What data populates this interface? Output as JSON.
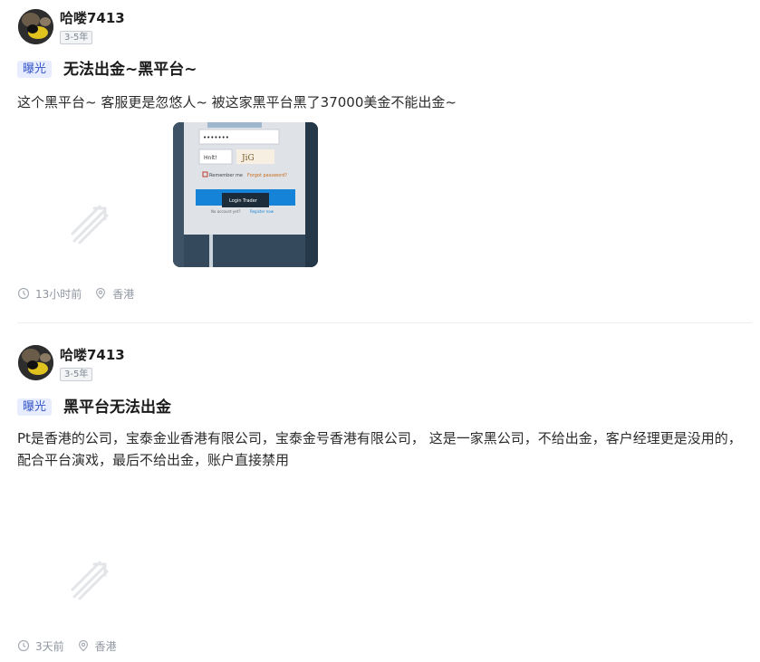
{
  "posts": [
    {
      "author": {
        "name": "哈喽7413",
        "badge": "3-5年"
      },
      "tag": "曝光",
      "title": "无法出金~黑平台~",
      "content": "这个黑平台~ 客服更是忽悠人~ 被这家黑平台黑了37000美金不能出金~",
      "image": {
        "password_dots": "•••••••",
        "captcha_field": "Hnlt!",
        "captcha_text": "JiG",
        "remember_label": "Remember me",
        "forgot_label": "Forgot password?",
        "login_button": "Login Trader",
        "register_prompt": "No account yet?",
        "register_link": "Register now"
      },
      "time": "13小时前",
      "location": "香港"
    },
    {
      "author": {
        "name": "哈喽7413",
        "badge": "3-5年"
      },
      "tag": "曝光",
      "title": "黑平台无法出金",
      "content": "Pt是香港的公司，宝泰金业香港有限公司，宝泰金号香港有限公司， 这是一家黑公司，不给出金，客户经理更是没用的，配合平台演戏，最后不给出金，账户直接禁用",
      "time": "3天前",
      "location": "香港"
    }
  ],
  "colors": {
    "tag_bg": "#e7ecff",
    "tag_text": "#3456c8",
    "meta_text": "#8f96a0",
    "login_blue": "#1583d7"
  }
}
